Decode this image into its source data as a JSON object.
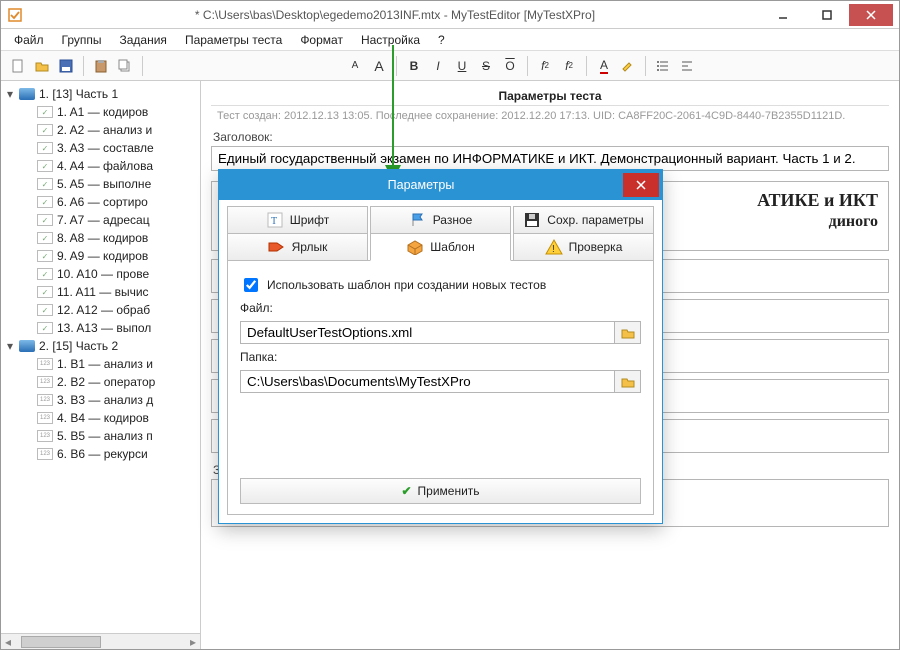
{
  "window": {
    "title": "* C:\\Users\\bas\\Desktop\\egedemo2013INF.mtx - MyTestEditor [MyTestXPro]"
  },
  "menu": [
    "Файл",
    "Группы",
    "Задания",
    "Параметры теста",
    "Формат",
    "Настройка",
    "?"
  ],
  "tree": {
    "group1": {
      "label": "1. [13] Часть 1",
      "items": [
        "1. A1 — кодиров",
        "2. A2 — анализ и",
        "3. A3 — составле",
        "4. A4 — файлова",
        "5. A5 — выполне",
        "6. A6 — сортиро",
        "7. A7 — адресац",
        "8. A8 — кодиров",
        "9. A9 — кодиров",
        "10. A10 — прове",
        "11. A11 — вычис",
        "12. A12 — обраб",
        "13. A13 — выпол"
      ]
    },
    "group2": {
      "label": "2. [15] Часть 2",
      "items": [
        "1. B1 — анализ и",
        "2. B2 — оператор",
        "3. B3 — анализ д",
        "4. B4 — кодиров",
        "5. B5 — анализ п",
        "6. B6 — рекурси"
      ]
    }
  },
  "main": {
    "panel_title": "Параметры теста",
    "meta": "Тест создан: 2012.12.13 13:05. Последнее сохранение: 2012.12.20 17:13. UID: CA8FF20C-2061-4C9D-8440-7B2355D1121D.",
    "header_label": "Заголовок:",
    "header_value": "Единый государственный экзамен по ИНФОРМАТИКЕ и ИКТ. Демонстрационный вариант. Часть 1 и 2.",
    "rich1_line1": "АТИКЕ и ИКТ",
    "rich1_line2": "диного",
    "notes_label": "Заметки:"
  },
  "dialog": {
    "title": "Параметры",
    "tabs_top": [
      "Шрифт",
      "Разное",
      "Сохр. параметры"
    ],
    "tabs_bottom": [
      "Ярлык",
      "Шаблон",
      "Проверка"
    ],
    "checkbox": "Использовать шаблон при создании новых тестов",
    "file_label": "Файл:",
    "file_value": "DefaultUserTestOptions.xml",
    "folder_label": "Папка:",
    "folder_value": "C:\\Users\\bas\\Documents\\MyTestXPro",
    "apply": "Применить"
  }
}
